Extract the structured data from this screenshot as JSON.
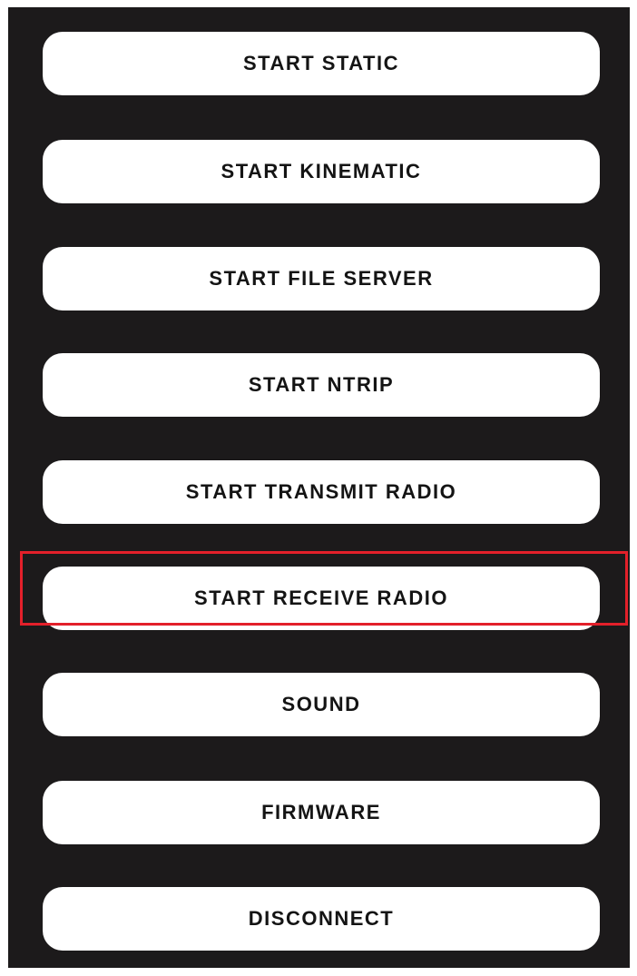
{
  "menu": {
    "items": [
      {
        "label": "START STATIC"
      },
      {
        "label": "START KINEMATIC"
      },
      {
        "label": "START FILE SERVER"
      },
      {
        "label": "START NTRIP"
      },
      {
        "label": "START TRANSMIT RADIO"
      },
      {
        "label": "START RECEIVE RADIO"
      },
      {
        "label": "SOUND"
      },
      {
        "label": "FIRMWARE"
      },
      {
        "label": "DISCONNECT"
      }
    ],
    "highlighted_item": "START RECEIVE RADIO"
  },
  "colors": {
    "background": "#1c1a1b",
    "button": "#ffffff",
    "button_text": "#141414",
    "highlight": "#e3202a"
  }
}
